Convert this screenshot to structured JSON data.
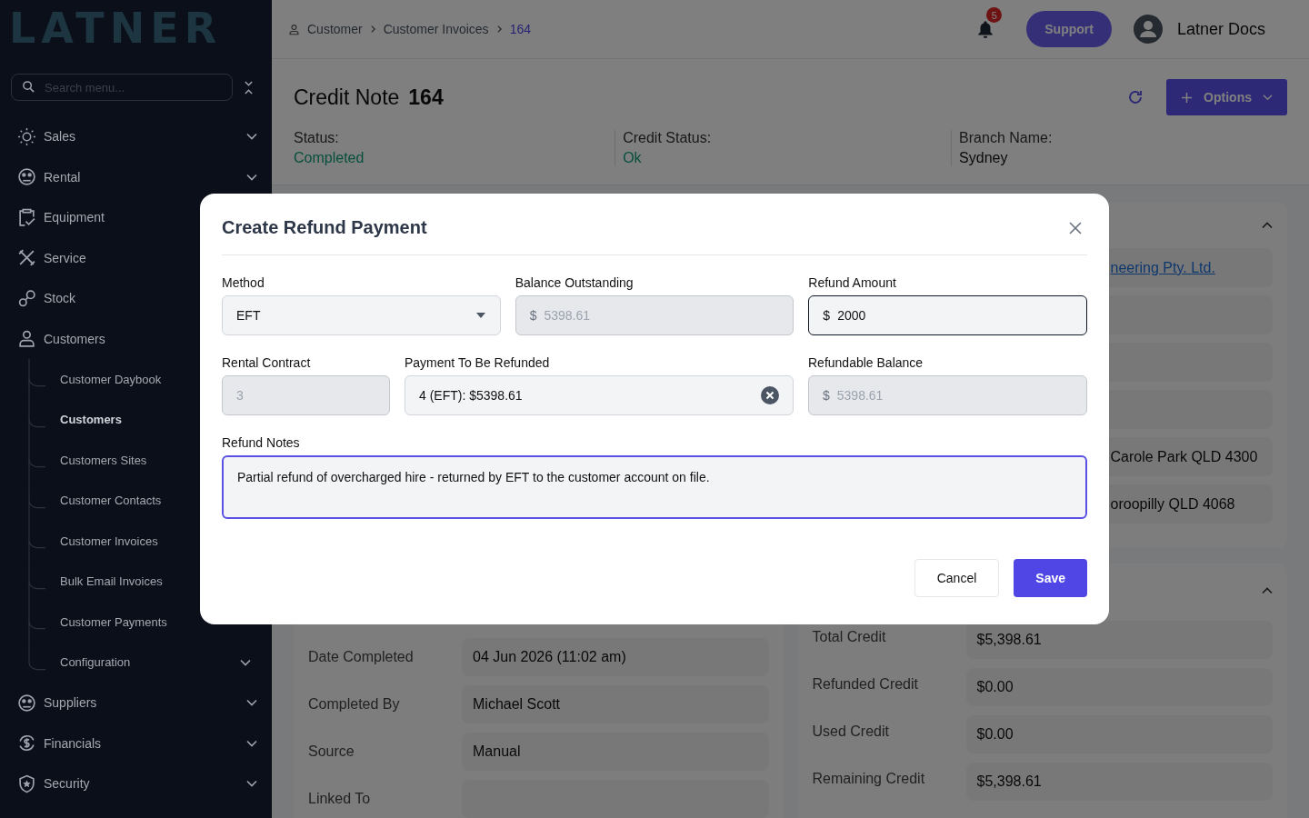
{
  "sidebar": {
    "logo": "LATNER",
    "search": {
      "placeholder": "Search menu..."
    },
    "items": [
      {
        "label": "Sales",
        "chevron": true,
        "expanded": false
      },
      {
        "label": "Rental",
        "chevron": true,
        "expanded": false
      },
      {
        "label": "Equipment"
      },
      {
        "label": "Service"
      },
      {
        "label": "Stock"
      },
      {
        "label": "Customers",
        "expanded": true,
        "children": [
          {
            "label": "Customer Daybook",
            "selected": false
          },
          {
            "label": "Customers",
            "selected": true
          },
          {
            "label": "Customers Sites",
            "selected": false
          },
          {
            "label": "Customer Contacts",
            "selected": false
          },
          {
            "label": "Customer Invoices",
            "selected": false
          },
          {
            "label": "Bulk Email Invoices",
            "selected": false
          },
          {
            "label": "Customer Payments",
            "selected": false
          },
          {
            "label": "Configuration",
            "selected": false,
            "chevron": true
          }
        ]
      },
      {
        "label": "Suppliers",
        "chevron": true,
        "expanded": false
      },
      {
        "label": "Financials",
        "chevron": true,
        "expanded": false
      },
      {
        "label": "Security",
        "chevron": true,
        "expanded": false
      }
    ]
  },
  "header": {
    "breadcrumb": [
      {
        "label": "Customer",
        "current": false
      },
      {
        "label": "Customer Invoices",
        "current": false
      },
      {
        "label": "164",
        "current": true
      }
    ],
    "notification_count": "5",
    "support": "Support",
    "user": "Latner Docs"
  },
  "page": {
    "title": "Credit Note",
    "number": "164",
    "options": "Options",
    "statuses": [
      {
        "label": "Status:",
        "value": "Completed",
        "success": true
      },
      {
        "label": "Credit Status:",
        "value": "Ok",
        "success": true
      },
      {
        "label": "Branch Name:",
        "value": "Sydney",
        "success": false
      }
    ]
  },
  "details_card": {
    "rows": [
      {
        "label": "Date Completed",
        "value": "04 Jun 2026 (11:02 am)"
      },
      {
        "label": "Completed By",
        "value": "Michael Scott"
      },
      {
        "label": "Source",
        "value": "Manual"
      },
      {
        "label": "Linked To"
      }
    ]
  },
  "customer_card": {
    "expanded": true,
    "rows": [
      {
        "kind": "link",
        "value": "neering Pty. Ltd."
      },
      {
        "kind": "empty"
      },
      {
        "kind": "empty"
      },
      {
        "kind": "empty"
      },
      {
        "kind": "text",
        "value": "Carole Park QLD 4300"
      },
      {
        "kind": "text",
        "value": "oroopilly QLD 4068"
      }
    ]
  },
  "credit_card": {
    "expanded": true,
    "rows": [
      {
        "label": "Total Credit",
        "value": "$5,398.61"
      },
      {
        "label": "Refunded Credit",
        "value": "$0.00"
      },
      {
        "label": "Used Credit",
        "value": "$0.00"
      },
      {
        "label": "Remaining Credit",
        "value": "$5,398.61"
      }
    ]
  },
  "modal": {
    "title": "Create Refund Payment",
    "rows": [
      [
        {
          "label": "Method",
          "kind": "select",
          "value": "EFT",
          "disabled": false,
          "focused": false
        },
        {
          "label": "Balance Outstanding",
          "kind": "currency",
          "prefix": "$",
          "value": "5398.61",
          "disabled": true,
          "focused": false
        },
        {
          "label": "Refund Amount",
          "kind": "currency",
          "prefix": "$",
          "value": "2000",
          "disabled": false,
          "focused": true
        }
      ],
      [
        {
          "label": "Rental Contract",
          "kind": "text",
          "value": "3",
          "disabled": true,
          "focused": false
        },
        {
          "label": "Payment To Be Refunded",
          "kind": "clearable",
          "value": "4 (EFT): $5398.61",
          "disabled": false,
          "focused": false
        },
        {
          "label": "Refundable Balance",
          "kind": "currency",
          "prefix": "$",
          "value": "5398.61",
          "disabled": true,
          "focused": false
        }
      ]
    ],
    "notes": {
      "label": "Refund Notes",
      "value": "Partial refund of overcharged hire - returned by EFT to the customer account on file.",
      "focused": true
    },
    "cancel": "Cancel",
    "save": "Save"
  }
}
